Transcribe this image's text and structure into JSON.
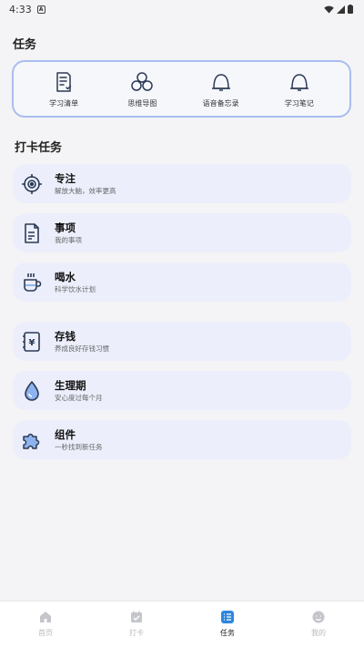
{
  "status_bar": {
    "time": "4:33"
  },
  "sections": {
    "tasks_title": "任务",
    "checkin_title": "打卡任务"
  },
  "quick_actions": [
    {
      "label": "学习清单",
      "icon": "checklist-book-icon"
    },
    {
      "label": "思维导图",
      "icon": "mind-map-icon"
    },
    {
      "label": "语音备忘录",
      "icon": "voice-bell-icon"
    },
    {
      "label": "学习笔记",
      "icon": "note-bell-icon"
    }
  ],
  "tasks": [
    {
      "name": "专注",
      "desc": "解放大脑，效率更高",
      "icon": "target-icon"
    },
    {
      "name": "事项",
      "desc": "我的事项",
      "icon": "document-icon"
    },
    {
      "name": "喝水",
      "desc": "科学饮水计划",
      "icon": "hot-cup-icon"
    },
    {
      "name": "存钱",
      "desc": "养成良好存钱习惯",
      "icon": "money-book-icon"
    },
    {
      "name": "生理期",
      "desc": "安心度过每个月",
      "icon": "water-drop-icon"
    },
    {
      "name": "组件",
      "desc": "一秒找到新任务",
      "icon": "puzzle-icon"
    }
  ],
  "tab_bar": [
    {
      "label": "首页",
      "icon": "home-icon",
      "active": false
    },
    {
      "label": "打卡",
      "icon": "calendar-check-icon",
      "active": false
    },
    {
      "label": "任务",
      "icon": "task-list-icon",
      "active": true
    },
    {
      "label": "我的",
      "icon": "profile-icon",
      "active": false
    }
  ],
  "colors": {
    "accent": "#2e86de",
    "card_border": "#a9bdf0",
    "task_bg": "#eceefb",
    "icon_stroke": "#2b3a55"
  }
}
